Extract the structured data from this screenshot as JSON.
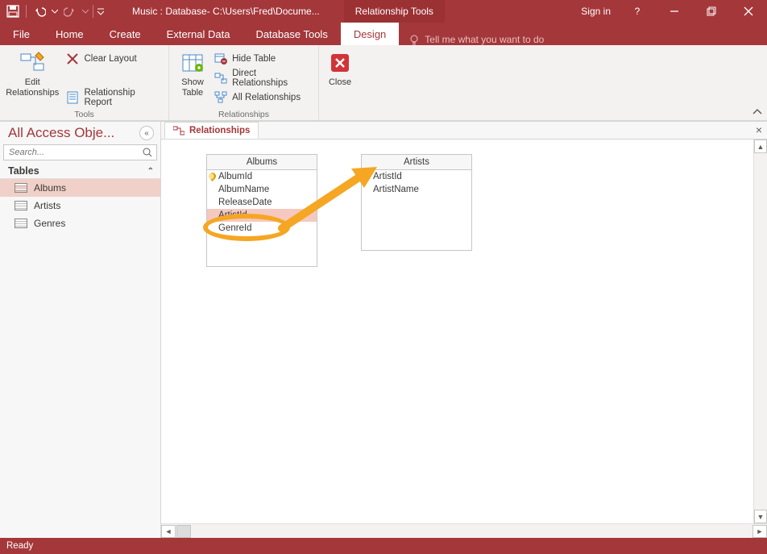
{
  "title": "Music : Database- C:\\Users\\Fred\\Docume...",
  "context_tab": "Relationship Tools",
  "signin": "Sign in",
  "ribbon_tabs": {
    "file": "File",
    "home": "Home",
    "create": "Create",
    "external": "External Data",
    "dbtools": "Database Tools",
    "design": "Design",
    "tell": "Tell me what you want to do"
  },
  "ribbon": {
    "edit_rel": "Edit\nRelationships",
    "clear_layout": "Clear Layout",
    "rel_report": "Relationship Report",
    "tools_label": "Tools",
    "show_table": "Show\nTable",
    "hide_table": "Hide Table",
    "direct_rel": "Direct Relationships",
    "all_rel": "All Relationships",
    "relationships_label": "Relationships",
    "close": "Close"
  },
  "nav": {
    "title": "All Access Obje...",
    "search_placeholder": "Search...",
    "group": "Tables",
    "items": [
      "Albums",
      "Artists",
      "Genres"
    ]
  },
  "doc": {
    "tab": "Relationships"
  },
  "tables": {
    "albums": {
      "title": "Albums",
      "fields": [
        "AlbumId",
        "AlbumName",
        "ReleaseDate",
        "ArtistId",
        "GenreId"
      ]
    },
    "artists": {
      "title": "Artists",
      "fields": [
        "ArtistId",
        "ArtistName"
      ]
    }
  },
  "status": "Ready"
}
